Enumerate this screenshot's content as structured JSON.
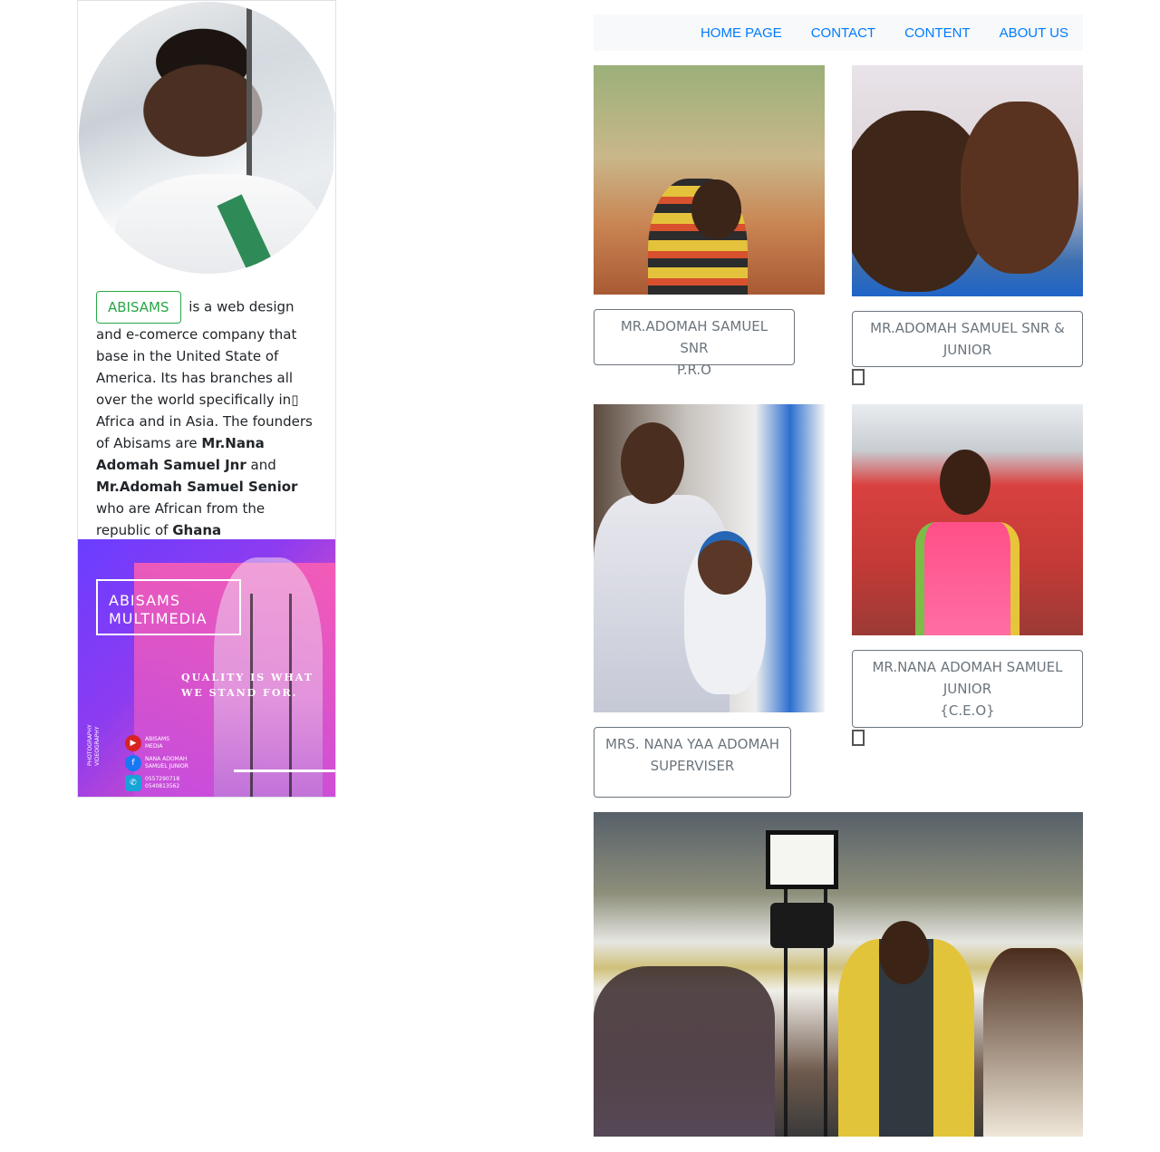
{
  "nav": {
    "items": [
      "HOME PAGE",
      "CONTACT",
      "CONTENT",
      "ABOUT US"
    ]
  },
  "profile": {
    "brand_button": "ABISAMS",
    "bio_intro": "is a web design and e-comerce company that base in the United State of America. Its has branches all over the world specifically in▯ Africa and in Asia. The founders of Abisams are",
    "founder1": "Mr.Nana Adomah Samuel Jnr",
    "and": "and",
    "founder2": "Mr.Adomah Samuel Senior",
    "bio_outro": "who are African from the republic of",
    "country": "Ghana"
  },
  "poster": {
    "title_line1": "ABISAMS",
    "title_line2": "MULTIMEDIA",
    "tagline_line1": "QUALITY IS WHAT",
    "tagline_line2": "WE STAND FOR.",
    "side_line1": "PHOTOGRAPHY",
    "side_line2": "VIDEOGRAPHY",
    "yt_line1": "ABISAMS",
    "yt_line2": "MEDIA",
    "fb_line1": "NANA ADOMAH",
    "fb_line2": "SAMUEL JUNIOR",
    "phone1": "0557290718",
    "phone2": "0540813562"
  },
  "captions": {
    "c1": [
      "MR.ADOMAH SAMUEL SNR",
      "P.R.O"
    ],
    "c2": [
      "MR.ADOMAH SAMUEL SNR &",
      "JUNIOR"
    ],
    "c3": [
      "MRS. NANA YAA ADOMAH",
      "SUPERVISER"
    ],
    "c4": [
      "MR.NANA ADOMAH SAMUEL",
      "JUNIOR",
      "{C.E.O}"
    ]
  },
  "colors": {
    "nav_link": "#007bff",
    "brand_green": "#28a745",
    "caption_gray": "#6c757d",
    "navbar_bg": "#f8f9fa"
  }
}
